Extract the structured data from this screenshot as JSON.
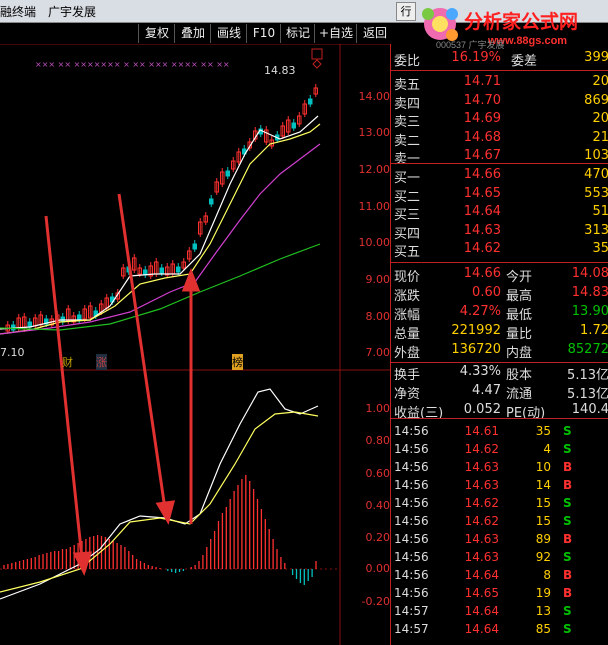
{
  "titlebar": {
    "app": "融终端",
    "stock": "广宇发展",
    "btn": "行"
  },
  "toolbar": {
    "items": [
      "复权",
      "叠加",
      "画线",
      "F10",
      "标记",
      "+自选",
      "返回"
    ]
  },
  "logo": {
    "brand": "分析家公式网",
    "url": "www.88gs.com",
    "sub": "000537 广宇发展"
  },
  "chart": {
    "price_axis": [
      "14.00",
      "13.00",
      "12.00",
      "11.00",
      "10.00",
      "9.00",
      "8.00",
      "7.00"
    ],
    "high_label": "14.83",
    "low_label": "7.10",
    "markers": [
      "财",
      "涨",
      "榜"
    ],
    "macd_axis": [
      "1.00",
      "0.80",
      "0.60",
      "0.40",
      "0.20",
      "0.00",
      "-0.20"
    ]
  },
  "quote": {
    "weibi": {
      "label": "委比",
      "value": "16.19%",
      "label2": "委差",
      "value2": "399"
    },
    "asks": [
      {
        "label": "卖五",
        "price": "14.71",
        "vol": "20"
      },
      {
        "label": "卖四",
        "price": "14.70",
        "vol": "869"
      },
      {
        "label": "卖三",
        "price": "14.69",
        "vol": "20"
      },
      {
        "label": "卖二",
        "price": "14.68",
        "vol": "21"
      },
      {
        "label": "卖一",
        "price": "14.67",
        "vol": "103"
      }
    ],
    "bids": [
      {
        "label": "买一",
        "price": "14.66",
        "vol": "470"
      },
      {
        "label": "买二",
        "price": "14.65",
        "vol": "553"
      },
      {
        "label": "买三",
        "price": "14.64",
        "vol": "51"
      },
      {
        "label": "买四",
        "price": "14.63",
        "vol": "313"
      },
      {
        "label": "买五",
        "price": "14.62",
        "vol": "35"
      }
    ],
    "stats": [
      {
        "l1": "现价",
        "v1": "14.66",
        "l2": "今开",
        "v2": "14.08"
      },
      {
        "l1": "涨跌",
        "v1": "0.60",
        "l2": "最高",
        "v2": "14.83"
      },
      {
        "l1": "涨幅",
        "v1": "4.27%",
        "l2": "最低",
        "v2": "13.90"
      },
      {
        "l1": "总量",
        "v1": "221992",
        "l2": "量比",
        "v2": "1.72"
      },
      {
        "l1": "外盘",
        "v1": "136720",
        "l2": "内盘",
        "v2": "85272"
      }
    ],
    "stats2": [
      {
        "l1": "换手",
        "v1": "4.33%",
        "l2": "股本",
        "v2": "5.13亿"
      },
      {
        "l1": "净资",
        "v1": "4.47",
        "l2": "流通",
        "v2": "5.13亿"
      },
      {
        "l1": "收益(三)",
        "v1": "0.052",
        "l2": "PE(动)",
        "v2": "140.4"
      }
    ],
    "ticks": [
      {
        "t": "14:56",
        "p": "14.61",
        "v": "35",
        "bs": "S"
      },
      {
        "t": "14:56",
        "p": "14.62",
        "v": "4",
        "bs": "S"
      },
      {
        "t": "14:56",
        "p": "14.63",
        "v": "10",
        "bs": "B"
      },
      {
        "t": "14:56",
        "p": "14.63",
        "v": "14",
        "bs": "B"
      },
      {
        "t": "14:56",
        "p": "14.62",
        "v": "15",
        "bs": "S"
      },
      {
        "t": "14:56",
        "p": "14.62",
        "v": "15",
        "bs": "S"
      },
      {
        "t": "14:56",
        "p": "14.63",
        "v": "89",
        "bs": "B"
      },
      {
        "t": "14:56",
        "p": "14.63",
        "v": "92",
        "bs": "S"
      },
      {
        "t": "14:56",
        "p": "14.64",
        "v": "8",
        "bs": "B"
      },
      {
        "t": "14:56",
        "p": "14.65",
        "v": "19",
        "bs": "B"
      },
      {
        "t": "14:57",
        "p": "14.64",
        "v": "13",
        "bs": "S"
      },
      {
        "t": "14:57",
        "p": "14.64",
        "v": "85",
        "bs": "S"
      }
    ]
  }
}
